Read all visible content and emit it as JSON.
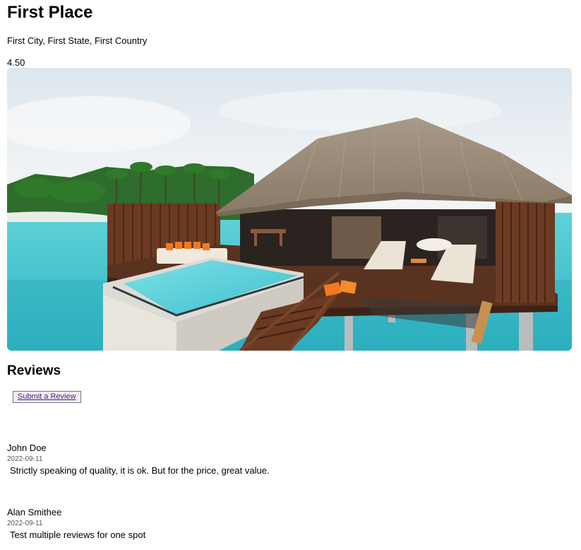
{
  "place": {
    "title": "First Place",
    "location": "First City, First State, First Country",
    "rating": "4.50"
  },
  "hero_image": {
    "description_icon": "overwater-villa-photo"
  },
  "reviews": {
    "heading": "Reviews",
    "submit_label": "Submit a Review",
    "items": [
      {
        "author": "John Doe",
        "date": "2022-09-11",
        "text": "Strictly speaking of quality, it is ok. But for the price, great value."
      },
      {
        "author": "Alan Smithee",
        "date": "2022-09-11",
        "text": "Test multiple reviews for one spot"
      }
    ]
  },
  "colors": {
    "link": "#551a8b",
    "water": "#3cc3cf",
    "sky": "#e8eef2"
  }
}
